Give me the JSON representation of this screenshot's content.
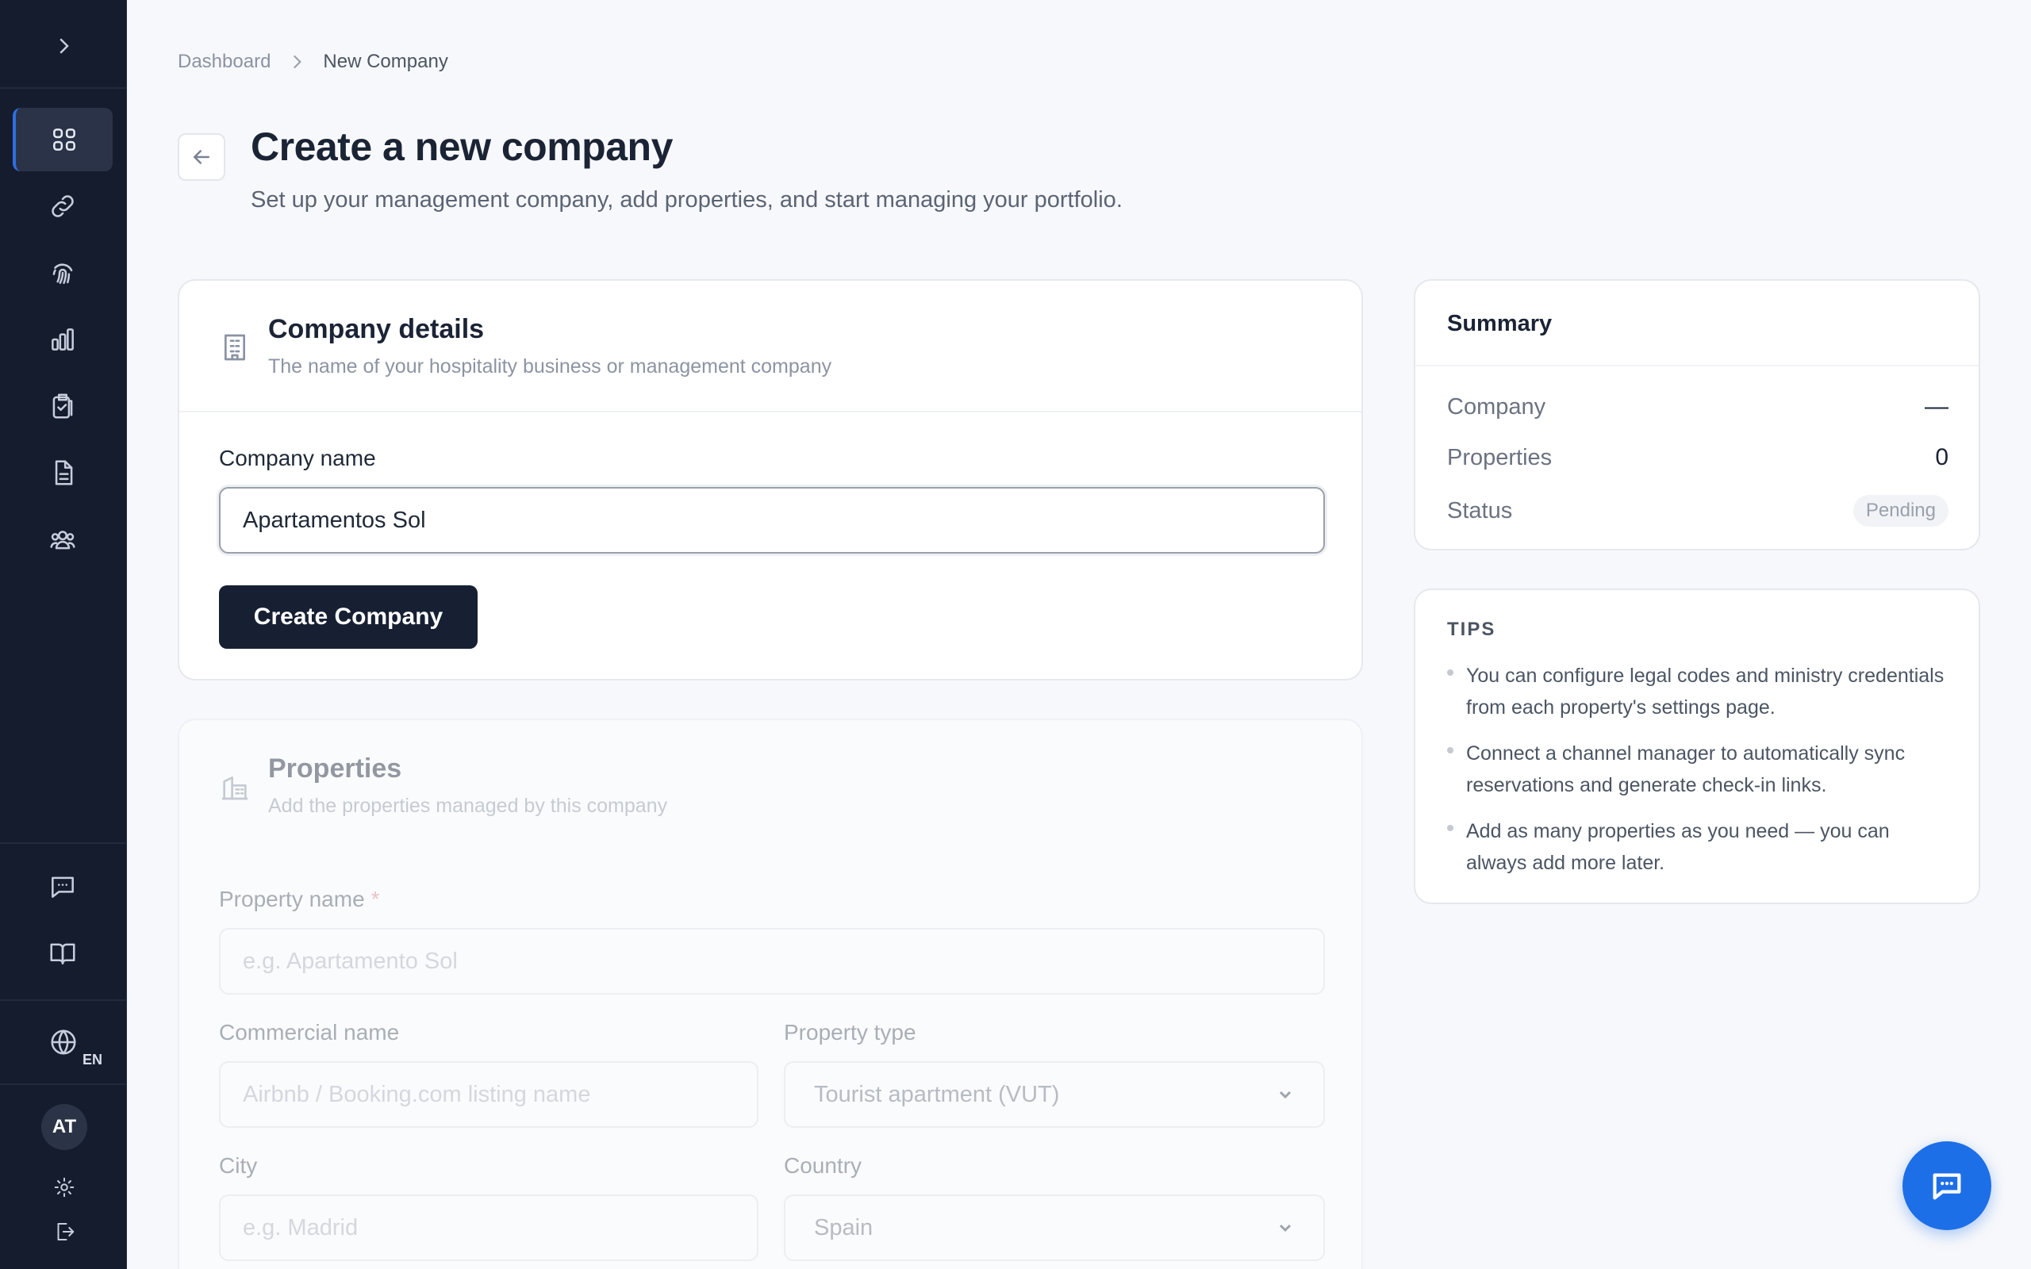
{
  "sidebar": {
    "expand_icon": "chevron-right-icon",
    "nav_icons": [
      "grid-icon",
      "link-icon",
      "fingerprint-icon",
      "bar-chart-icon",
      "clipboard-check-icon",
      "document-icon",
      "users-icon"
    ],
    "bottom_icons": [
      "message-icon",
      "book-icon"
    ],
    "language_icon": "globe-icon",
    "language_code": "EN",
    "avatar_initials": "AT",
    "settings_icon": "gear-icon",
    "logout_icon": "logout-icon"
  },
  "breadcrumb": {
    "root": "Dashboard",
    "current": "New Company"
  },
  "header": {
    "title": "Create a new company",
    "subtitle": "Set up your management company, add properties, and start managing your portfolio."
  },
  "company_details": {
    "title": "Company details",
    "description": "The name of your hospitality business or management company",
    "company_name_label": "Company name",
    "company_name_value": "Apartamentos Sol",
    "submit_label": "Create Company"
  },
  "properties": {
    "title": "Properties",
    "description": "Add the properties managed by this company",
    "property_name_label": "Property name",
    "required_mark": "*",
    "property_name_placeholder": "e.g. Apartamento Sol",
    "commercial_name_label": "Commercial name",
    "commercial_name_placeholder": "Airbnb / Booking.com listing name",
    "property_type_label": "Property type",
    "property_type_value": "Tourist apartment (VUT)",
    "city_label": "City",
    "city_placeholder": "e.g. Madrid",
    "country_label": "Country",
    "country_value": "Spain"
  },
  "summary": {
    "title": "Summary",
    "rows": [
      {
        "key": "Company",
        "value": "—"
      },
      {
        "key": "Properties",
        "value": "0"
      },
      {
        "key": "Status",
        "value": "Pending"
      }
    ]
  },
  "tips": {
    "title": "TIPS",
    "items": [
      "You can configure legal codes and ministry credentials from each property's settings page.",
      "Connect a channel manager to automatically sync reservations and generate check-in links.",
      "Add as many properties as you need — you can always add more later."
    ]
  },
  "colors": {
    "sidebar_bg": "#141c2e",
    "accent": "#1d6fe8",
    "primary_button": "#172033"
  }
}
